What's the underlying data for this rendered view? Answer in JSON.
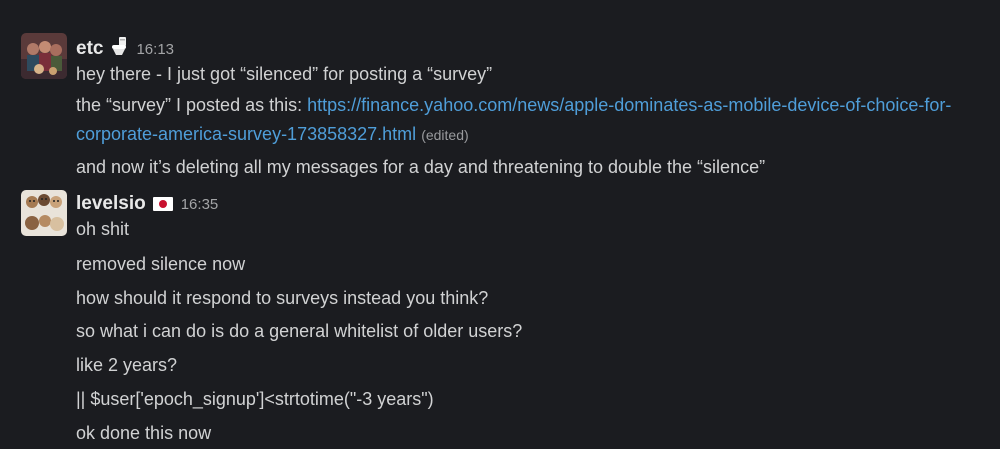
{
  "messages": [
    {
      "user": "etc",
      "timestamp": "16:13",
      "status_icon": "toilet-icon",
      "lines": [
        "hey there - I just got “silenced” for posting a “survey”",
        {
          "prefix": "the “survey” I posted as this: ",
          "link": "https://finance.yahoo.com/news/apple-dominates-as-mobile-device-of-choice-for-corporate-america-survey-173858327.html",
          "edited": "(edited)"
        },
        "and now it’s deleting all my messages for a day and threatening to double the “silence”"
      ]
    },
    {
      "user": "levelsio",
      "timestamp": "16:35",
      "status_icon": "japan-flag-icon",
      "lines": [
        "oh shit",
        "removed silence now",
        "how should it respond to surveys instead you think?",
        "so what i can do is do a general whitelist of older users?",
        "like 2 years?",
        "|| $user['epoch_signup']<strtotime(\"-3 years\")",
        "ok done this now"
      ]
    }
  ],
  "colors": {
    "background": "#1b1c20",
    "text": "#d1d2d3",
    "link": "#4f9ed9",
    "muted": "#a3a4a6"
  }
}
